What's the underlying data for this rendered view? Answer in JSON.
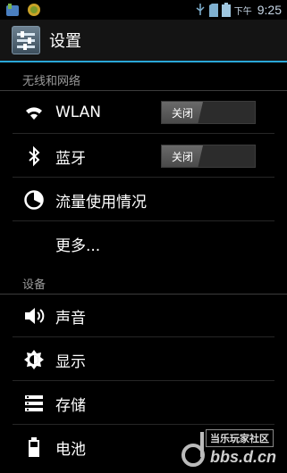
{
  "status_bar": {
    "ampm": "下午",
    "time": "9:25",
    "icons": [
      "app-notification-icon",
      "app-notification-icon-2",
      "usb-icon",
      "sd-card-icon",
      "battery-icon"
    ]
  },
  "action_bar": {
    "title": "设置",
    "accent": "#2aa7d8"
  },
  "sections": [
    {
      "header": "无线和网络",
      "items": [
        {
          "label": "WLAN",
          "icon": "wifi-icon",
          "toggle": "关闭"
        },
        {
          "label": "蓝牙",
          "icon": "bluetooth-icon",
          "toggle": "关闭"
        },
        {
          "label": "流量使用情况",
          "icon": "data-usage-icon"
        },
        {
          "label": "更多..."
        }
      ]
    },
    {
      "header": "设备",
      "items": [
        {
          "label": "声音",
          "icon": "volume-icon"
        },
        {
          "label": "显示",
          "icon": "brightness-icon"
        },
        {
          "label": "存储",
          "icon": "storage-icon"
        },
        {
          "label": "电池",
          "icon": "battery-icon"
        }
      ]
    }
  ],
  "watermark": {
    "line1": "当乐玩家社区",
    "line2": "bbs.d.cn"
  }
}
